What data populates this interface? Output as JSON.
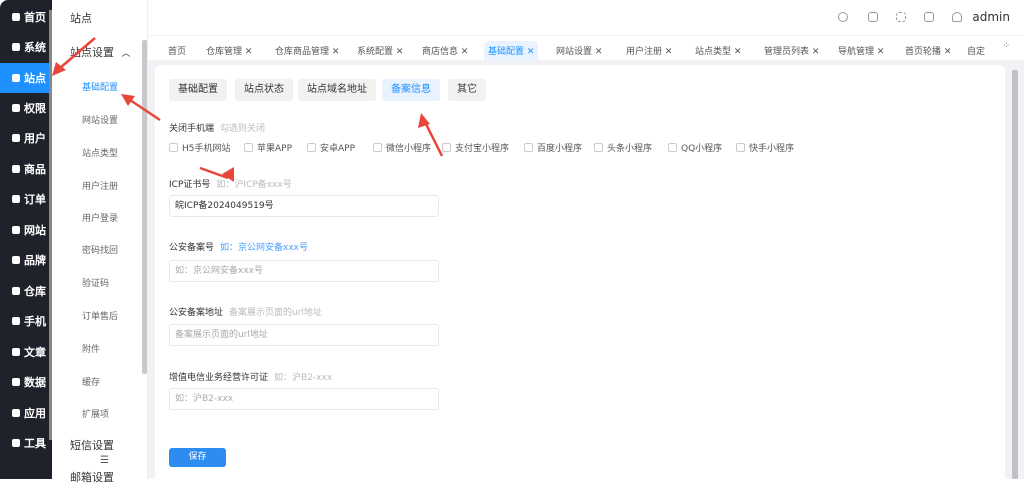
{
  "sidebar": {
    "items": [
      {
        "label": "首页",
        "icon": "home-icon"
      },
      {
        "label": "系统",
        "icon": "gear-icon"
      },
      {
        "label": "站点",
        "icon": "sliders-icon",
        "active": true
      },
      {
        "label": "权限",
        "icon": "user-lock-icon"
      },
      {
        "label": "用户",
        "icon": "user-icon"
      },
      {
        "label": "商品",
        "icon": "goods-icon"
      },
      {
        "label": "订单",
        "icon": "order-icon"
      },
      {
        "label": "网站",
        "icon": "monitor-icon"
      },
      {
        "label": "品牌",
        "icon": "brand-icon"
      },
      {
        "label": "仓库",
        "icon": "warehouse-icon"
      },
      {
        "label": "手机",
        "icon": "phone-icon"
      },
      {
        "label": "文章",
        "icon": "article-icon"
      },
      {
        "label": "数据",
        "icon": "chart-icon"
      },
      {
        "label": "应用",
        "icon": "apps-icon"
      },
      {
        "label": "工具",
        "icon": "wrench-icon"
      }
    ]
  },
  "submenu": {
    "title": "站点",
    "group": "站点设置",
    "items": [
      "基础配置",
      "网站设置",
      "站点类型",
      "用户注册",
      "用户登录",
      "密码找回",
      "验证码",
      "订单售后",
      "附件",
      "缓存",
      "扩展项"
    ],
    "active": "基础配置",
    "group2": "短信设置",
    "group3": "邮箱设置"
  },
  "header": {
    "icons": [
      "palette-icon",
      "clean-icon",
      "fullscreen-icon",
      "home-icon",
      "bell-icon"
    ],
    "user": "admin"
  },
  "tabs": [
    {
      "label": "首页"
    },
    {
      "label": "仓库管理 ✕"
    },
    {
      "label": "仓库商品管理 ✕"
    },
    {
      "label": "系统配置 ✕"
    },
    {
      "label": "商店信息 ✕"
    },
    {
      "label": "基础配置 ✕",
      "active": true
    },
    {
      "label": "网站设置 ✕"
    },
    {
      "label": "用户注册 ✕"
    },
    {
      "label": "站点类型 ✕"
    },
    {
      "label": "管理员列表 ✕"
    },
    {
      "label": "导航管理 ✕"
    },
    {
      "label": "首页轮播 ✕"
    },
    {
      "label": "自定"
    }
  ],
  "subtabs": [
    {
      "label": "基础配置"
    },
    {
      "label": "站点状态"
    },
    {
      "label": "站点域名地址"
    },
    {
      "label": "备案信息",
      "active": true
    },
    {
      "label": "其它"
    }
  ],
  "form": {
    "mobile_close": {
      "label": "关闭手机端",
      "hint": "勾选则关闭",
      "options": [
        "H5手机网站",
        "苹果APP",
        "安卓APP",
        "微信小程序",
        "支付宝小程序",
        "百度小程序",
        "头条小程序",
        "QQ小程序",
        "快手小程序"
      ]
    },
    "icp": {
      "label": "ICP证书号",
      "hint": "如：沪ICP备xxx号",
      "value": "皖ICP备2024049519号"
    },
    "police": {
      "label": "公安备案号",
      "hint": "如：京公网安备xxx号",
      "placeholder": "如：京公网安备xxx号"
    },
    "police_url": {
      "label": "公安备案地址",
      "hint": "备案展示页面的url地址",
      "placeholder": "备案展示页面的url地址"
    },
    "telecom": {
      "label": "增值电信业务经营许可证",
      "hint": "如：沪B2-xxx",
      "placeholder": "如：沪B2-xxx"
    },
    "save": "保存"
  },
  "colors": {
    "accent": "#1e90ff",
    "sidebar": "#1f222b",
    "arrow": "#e8463a"
  }
}
